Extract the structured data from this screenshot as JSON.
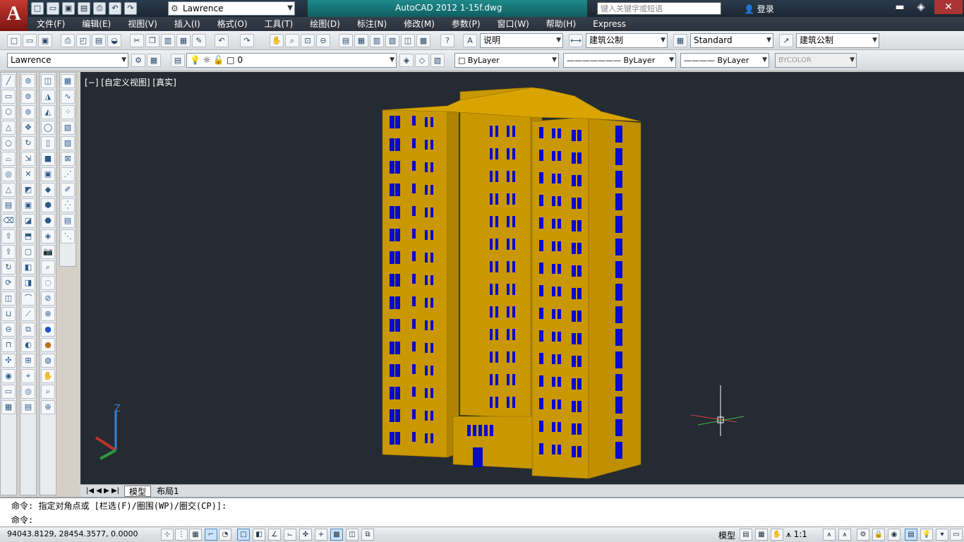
{
  "title": {
    "app_letter": "A",
    "workspace": "Lawrence",
    "window_title": "AutoCAD 2012    1-15f.dwg",
    "search_placeholder": "键入关键字或短语",
    "login": "登录"
  },
  "menu": [
    "文件(F)",
    "编辑(E)",
    "视图(V)",
    "插入(I)",
    "格式(O)",
    "工具(T)",
    "绘图(D)",
    "标注(N)",
    "修改(M)",
    "参数(P)",
    "窗口(W)",
    "帮助(H)",
    "Express"
  ],
  "toolbar1": {
    "text_style": "说明",
    "dim_style": "建筑公制",
    "table_style": "Standard",
    "mleader_style": "建筑公制"
  },
  "toolbar2": {
    "workspace": "Lawrence",
    "layer": "0",
    "color": "ByLayer",
    "linetype": "ByLayer",
    "lineweight": "ByLayer",
    "plotstyle": "BYCOLOR"
  },
  "viewport": {
    "label": "[−] [自定义视图] [真实]",
    "axis_z": "Z",
    "building_color": "#c99700",
    "window_color": "#0a0acb",
    "background": "#252b33"
  },
  "tabs": [
    "模型",
    "布局1"
  ],
  "command": {
    "history": "命令: 指定对角点或 [栏选(F)/圈围(WP)/圈交(CP)]:",
    "prompt": "命令:"
  },
  "status": {
    "coords": "94043.8129,  28454.3577, 0.0000",
    "model": "模型",
    "scale": "1:1"
  }
}
